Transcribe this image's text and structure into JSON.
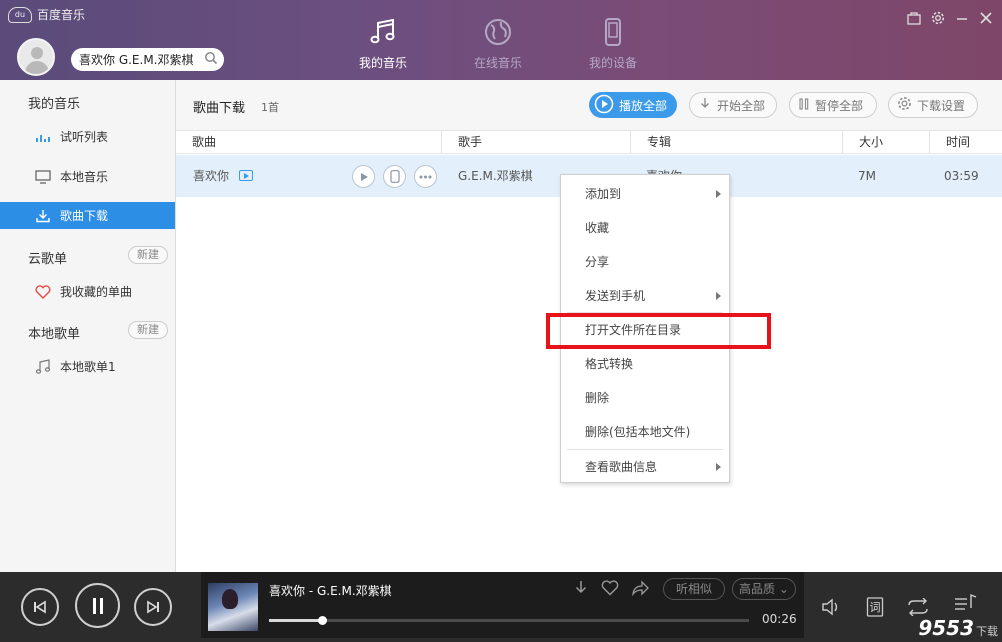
{
  "app": {
    "logo_text": "du",
    "title": "百度音乐"
  },
  "search": {
    "value": "喜欢你 G.E.M.邓紫棋"
  },
  "nav": [
    {
      "label": "我的音乐",
      "icon": "music-note-icon",
      "active": true
    },
    {
      "label": "在线音乐",
      "icon": "globe-icon",
      "active": false
    },
    {
      "label": "我的设备",
      "icon": "phone-device-icon",
      "active": false
    }
  ],
  "sidebar": {
    "my_music": "我的音乐",
    "items": [
      {
        "label": "试听列表",
        "icon": "equalizer-icon"
      },
      {
        "label": "本地音乐",
        "icon": "monitor-icon"
      },
      {
        "label": "歌曲下载",
        "icon": "download-icon",
        "active": true
      }
    ],
    "cloud_list": "云歌单",
    "cloud_new": "新建",
    "cloud_items": [
      {
        "label": "我收藏的单曲",
        "icon": "heart-icon"
      }
    ],
    "local_list": "本地歌单",
    "local_new": "新建",
    "local_items": [
      {
        "label": "本地歌单1",
        "icon": "music-note-icon"
      }
    ]
  },
  "content": {
    "title": "歌曲下载",
    "count": "1首",
    "buttons": {
      "play_all": "播放全部",
      "start_all": "开始全部",
      "pause_all": "暂停全部",
      "settings": "下载设置"
    },
    "columns": [
      "歌曲",
      "歌手",
      "专辑",
      "大小",
      "时间"
    ],
    "rows": [
      {
        "song": "喜欢你",
        "artist": "G.E.M.邓紫棋",
        "album": "喜欢你",
        "size": "7M",
        "time": "03:59"
      }
    ]
  },
  "context_menu": [
    {
      "label": "添加到",
      "submenu": true
    },
    {
      "label": "收藏"
    },
    {
      "label": "分享"
    },
    {
      "label": "发送到手机",
      "submenu": true
    },
    {
      "label": "打开文件所在目录",
      "highlighted": true
    },
    {
      "label": "格式转换"
    },
    {
      "label": "删除"
    },
    {
      "label": "删除(包括本地文件)"
    },
    {
      "label": "查看歌曲信息",
      "submenu": true
    }
  ],
  "player": {
    "now_playing": "喜欢你 - G.E.M.邓紫棋",
    "similar": "听相似",
    "quality": "高品质",
    "time": "00:26",
    "progress": 0.11,
    "lyrics_label": "词"
  },
  "watermark": {
    "main": "9553",
    "sub": "下载"
  },
  "colors": {
    "accent": "#2c8ee5",
    "highlight_box": "#e8121b"
  }
}
